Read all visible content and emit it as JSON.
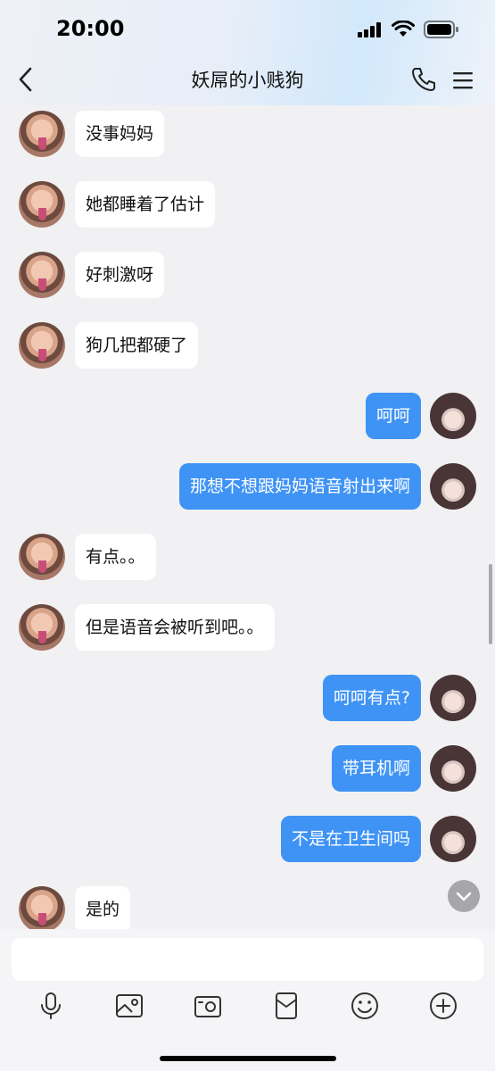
{
  "status_bar": {
    "time": "20:00"
  },
  "nav": {
    "title": "妖屌的小贱狗"
  },
  "messages": [
    {
      "side": "other",
      "text": "没事妈妈"
    },
    {
      "side": "other",
      "text": "她都睡着了估计"
    },
    {
      "side": "other",
      "text": "好刺激呀"
    },
    {
      "side": "other",
      "text": "狗几把都硬了"
    },
    {
      "side": "self",
      "text": "呵呵"
    },
    {
      "side": "self",
      "text": "那想不想跟妈妈语音射出来啊"
    },
    {
      "side": "other",
      "text": "有点。。"
    },
    {
      "side": "other",
      "text": "但是语音会被听到吧。。"
    },
    {
      "side": "self",
      "text": "呵呵有点?"
    },
    {
      "side": "self",
      "text": "带耳机啊"
    },
    {
      "side": "self",
      "text": "不是在卫生间吗"
    },
    {
      "side": "other",
      "text": "是的"
    }
  ],
  "input": {
    "value": ""
  },
  "toolbar": [
    "mic-icon",
    "image-icon",
    "camera-icon",
    "red-packet-icon",
    "emoji-icon",
    "plus-icon"
  ],
  "colors": {
    "self_bubble": "#3f93f5",
    "other_bubble": "#ffffff",
    "background": "#f1f1f3"
  }
}
